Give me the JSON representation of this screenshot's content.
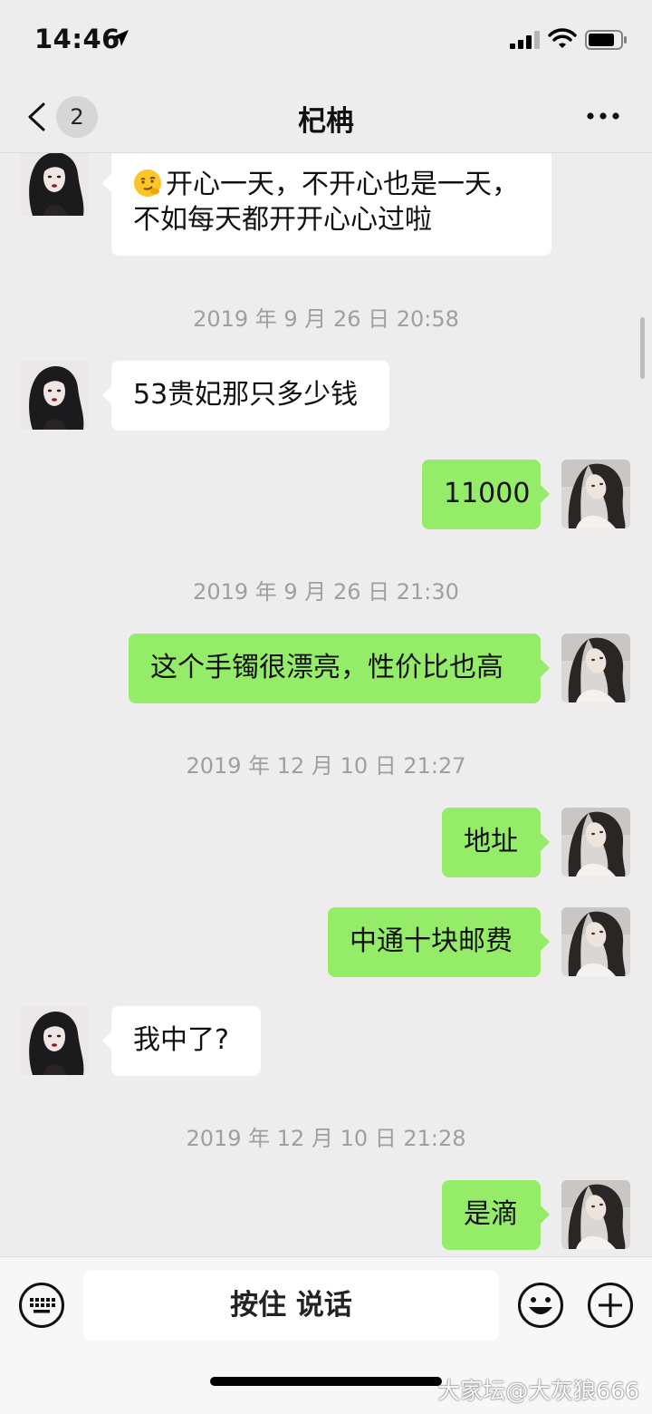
{
  "status_bar": {
    "time": "14:46",
    "icons": [
      "location-arrow-icon",
      "signal-icon",
      "wifi-icon",
      "battery-icon"
    ]
  },
  "nav": {
    "back_icon": "chevron-left-icon",
    "unread_count": "2",
    "title": "杞柟",
    "more_icon": "more-dots-icon"
  },
  "messages": [
    {
      "type": "in",
      "text_line1": "开心一天，不开心也是一天，",
      "text_line2": "不如每天都开开心心过啦",
      "emoji": "smirk-emoji"
    },
    {
      "type": "time",
      "text": "2019 年 9 月 26 日  20:58"
    },
    {
      "type": "in",
      "text": "53贵妃那只多少钱"
    },
    {
      "type": "out",
      "text": "11000"
    },
    {
      "type": "time",
      "text": "2019 年 9 月 26 日  21:30"
    },
    {
      "type": "out",
      "text": "这个手镯很漂亮，性价比也高"
    },
    {
      "type": "time",
      "text": "2019 年 12 月 10 日  21:27"
    },
    {
      "type": "out",
      "text": "地址"
    },
    {
      "type": "out",
      "text": "中通十块邮费"
    },
    {
      "type": "in",
      "text": "我中了?"
    },
    {
      "type": "time",
      "text": "2019 年 12 月 10 日  21:28"
    },
    {
      "type": "out",
      "text": "是滴"
    }
  ],
  "input_bar": {
    "keyboard_icon": "keyboard-icon",
    "hold_to_talk": "按住 说话",
    "emoji_icon": "emoji-icon",
    "plus_icon": "plus-icon"
  },
  "watermark": "大家坛@大灰狼666",
  "colors": {
    "background": "#ededed",
    "outgoing_bubble": "#95ec69",
    "incoming_bubble": "#ffffff",
    "timestamp_text": "#9f9f9f"
  }
}
